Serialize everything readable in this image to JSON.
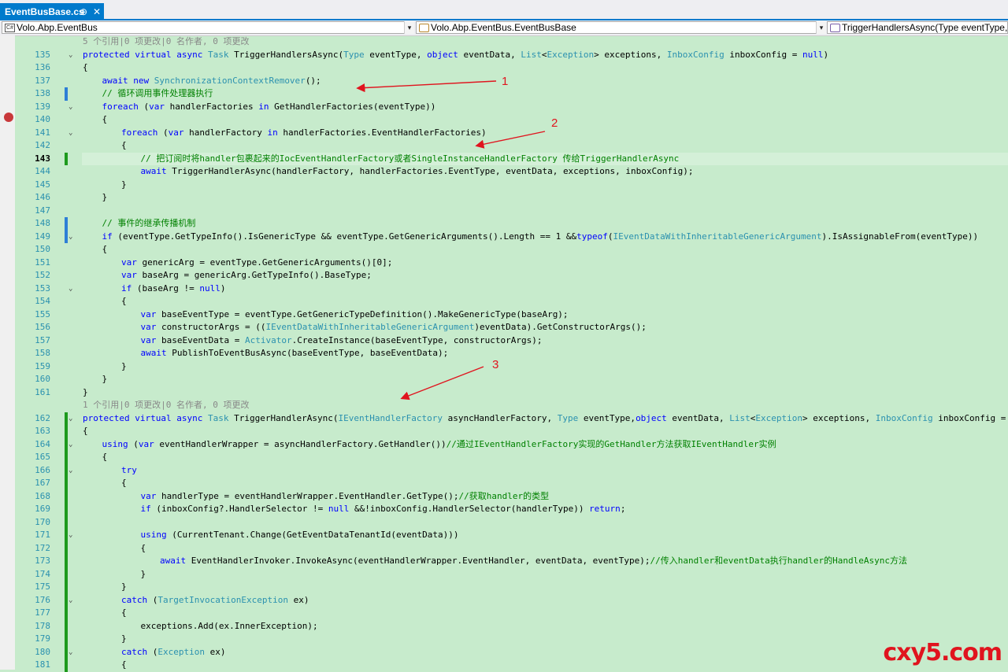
{
  "tab": {
    "title": "EventBusBase.cs",
    "pin": "⊕",
    "close": "✕"
  },
  "navbar": {
    "project": "Volo.Abp.EventBus",
    "project_icon": "C#",
    "type": "Volo.Abp.EventBus.EventBusBase",
    "member": "TriggerHandlersAsync(Type eventType, ob",
    "dropdown": "▾"
  },
  "lines": [
    {
      "num": "",
      "text": "5 个引用|0 项更改|0 名作者, 0 项更改",
      "indent": 1,
      "meta": true
    },
    {
      "num": "135",
      "text": "protected virtual async Task TriggerHandlersAsync(Type eventType, object eventData, List<Exception> exceptions, InboxConfig inboxConfig = null)",
      "indent": 1,
      "fold": "⌄"
    },
    {
      "num": "136",
      "text": "{",
      "indent": 1
    },
    {
      "num": "137",
      "text": "await new SynchronizationContextRemover();",
      "indent": 2
    },
    {
      "num": "138",
      "text": "// 循环调用事件处理器执行",
      "indent": 2,
      "comment": true,
      "change": "blue"
    },
    {
      "num": "139",
      "text": "foreach (var handlerFactories in GetHandlerFactories(eventType))",
      "indent": 2,
      "fold": "⌄"
    },
    {
      "num": "140",
      "text": "{",
      "indent": 2
    },
    {
      "num": "141",
      "text": "foreach (var handlerFactory in handlerFactories.EventHandlerFactories)",
      "indent": 3,
      "fold": "⌄"
    },
    {
      "num": "142",
      "text": "{",
      "indent": 3
    },
    {
      "num": "143",
      "text": "// 把订阅时将handler包裹起来的IocEventHandlerFactory或者SingleInstanceHandlerFactory 传给TriggerHandlerAsync",
      "indent": 4,
      "comment": true,
      "change": "green",
      "current": true
    },
    {
      "num": "144",
      "text": "await TriggerHandlerAsync(handlerFactory, handlerFactories.EventType, eventData, exceptions, inboxConfig);",
      "indent": 4
    },
    {
      "num": "145",
      "text": "}",
      "indent": 3
    },
    {
      "num": "146",
      "text": "}",
      "indent": 2
    },
    {
      "num": "147",
      "text": "",
      "indent": 0
    },
    {
      "num": "148",
      "text": "// 事件的继承传播机制",
      "indent": 2,
      "comment": true,
      "change": "blue"
    },
    {
      "num": "149",
      "text": "if (eventType.GetTypeInfo().IsGenericType && eventType.GetGenericArguments().Length == 1 &&typeof(IEventDataWithInheritableGenericArgument).IsAssignableFrom(eventType))",
      "indent": 2,
      "fold": "⌄",
      "change": "blue"
    },
    {
      "num": "150",
      "text": "{",
      "indent": 2
    },
    {
      "num": "151",
      "text": "var genericArg = eventType.GetGenericArguments()[0];",
      "indent": 3
    },
    {
      "num": "152",
      "text": "var baseArg = genericArg.GetTypeInfo().BaseType;",
      "indent": 3
    },
    {
      "num": "153",
      "text": "if (baseArg != null)",
      "indent": 3,
      "fold": "⌄"
    },
    {
      "num": "154",
      "text": "{",
      "indent": 3
    },
    {
      "num": "155",
      "text": "var baseEventType = eventType.GetGenericTypeDefinition().MakeGenericType(baseArg);",
      "indent": 4
    },
    {
      "num": "156",
      "text": "var constructorArgs = ((IEventDataWithInheritableGenericArgument)eventData).GetConstructorArgs();",
      "indent": 4
    },
    {
      "num": "157",
      "text": "var baseEventData = Activator.CreateInstance(baseEventType, constructorArgs);",
      "indent": 4
    },
    {
      "num": "158",
      "text": "await PublishToEventBusAsync(baseEventType, baseEventData);",
      "indent": 4
    },
    {
      "num": "159",
      "text": "}",
      "indent": 3
    },
    {
      "num": "160",
      "text": "}",
      "indent": 2
    },
    {
      "num": "161",
      "text": "}",
      "indent": 1
    },
    {
      "num": "",
      "text": "1 个引用|0 项更改|0 名作者, 0 项更改",
      "indent": 1,
      "meta": true
    },
    {
      "num": "162",
      "text": "protected virtual async Task TriggerHandlerAsync(IEventHandlerFactory asyncHandlerFactory, Type eventType,object eventData, List<Exception> exceptions, InboxConfig inboxConfig = null)",
      "indent": 1,
      "fold": "⌄",
      "change": "green"
    },
    {
      "num": "163",
      "text": "{",
      "indent": 1,
      "change": "green"
    },
    {
      "num": "164",
      "text": "using (var eventHandlerWrapper = asyncHandlerFactory.GetHandler())//通过IEventHandlerFactory实现的GetHandler方法获取IEventHandler实例",
      "indent": 2,
      "fold": "⌄",
      "change": "green"
    },
    {
      "num": "165",
      "text": "{",
      "indent": 2,
      "change": "green"
    },
    {
      "num": "166",
      "text": "try",
      "indent": 3,
      "fold": "⌄",
      "change": "green"
    },
    {
      "num": "167",
      "text": "{",
      "indent": 3,
      "change": "green"
    },
    {
      "num": "168",
      "text": "var handlerType = eventHandlerWrapper.EventHandler.GetType();//获取handler的类型",
      "indent": 4,
      "change": "green"
    },
    {
      "num": "169",
      "text": "if (inboxConfig?.HandlerSelector != null &&!inboxConfig.HandlerSelector(handlerType)) return;",
      "indent": 4,
      "change": "green"
    },
    {
      "num": "170",
      "text": "",
      "indent": 0,
      "change": "green"
    },
    {
      "num": "171",
      "text": "using (CurrentTenant.Change(GetEventDataTenantId(eventData)))",
      "indent": 4,
      "fold": "⌄",
      "change": "green"
    },
    {
      "num": "172",
      "text": "{",
      "indent": 4,
      "change": "green"
    },
    {
      "num": "173",
      "text": "await EventHandlerInvoker.InvokeAsync(eventHandlerWrapper.EventHandler, eventData, eventType);//传入handler和eventData执行handler的HandleAsync方法",
      "indent": 5,
      "change": "green"
    },
    {
      "num": "174",
      "text": "}",
      "indent": 4,
      "change": "green"
    },
    {
      "num": "175",
      "text": "}",
      "indent": 3,
      "change": "green"
    },
    {
      "num": "176",
      "text": "catch (TargetInvocationException ex)",
      "indent": 3,
      "fold": "⌄",
      "change": "green"
    },
    {
      "num": "177",
      "text": "{",
      "indent": 3,
      "change": "green"
    },
    {
      "num": "178",
      "text": "exceptions.Add(ex.InnerException);",
      "indent": 4,
      "change": "green"
    },
    {
      "num": "179",
      "text": "}",
      "indent": 3,
      "change": "green"
    },
    {
      "num": "180",
      "text": "catch (Exception ex)",
      "indent": 3,
      "fold": "⌄",
      "change": "green"
    },
    {
      "num": "181",
      "text": "{",
      "indent": 3,
      "change": "green"
    }
  ],
  "annotations": [
    "1",
    "2",
    "3"
  ],
  "watermark": "cxy5.com",
  "colors": {
    "annotation": "#e0141e",
    "change_green": "#1d9a1d",
    "change_blue": "#2e7fd6",
    "background": "#c7ebcc"
  }
}
